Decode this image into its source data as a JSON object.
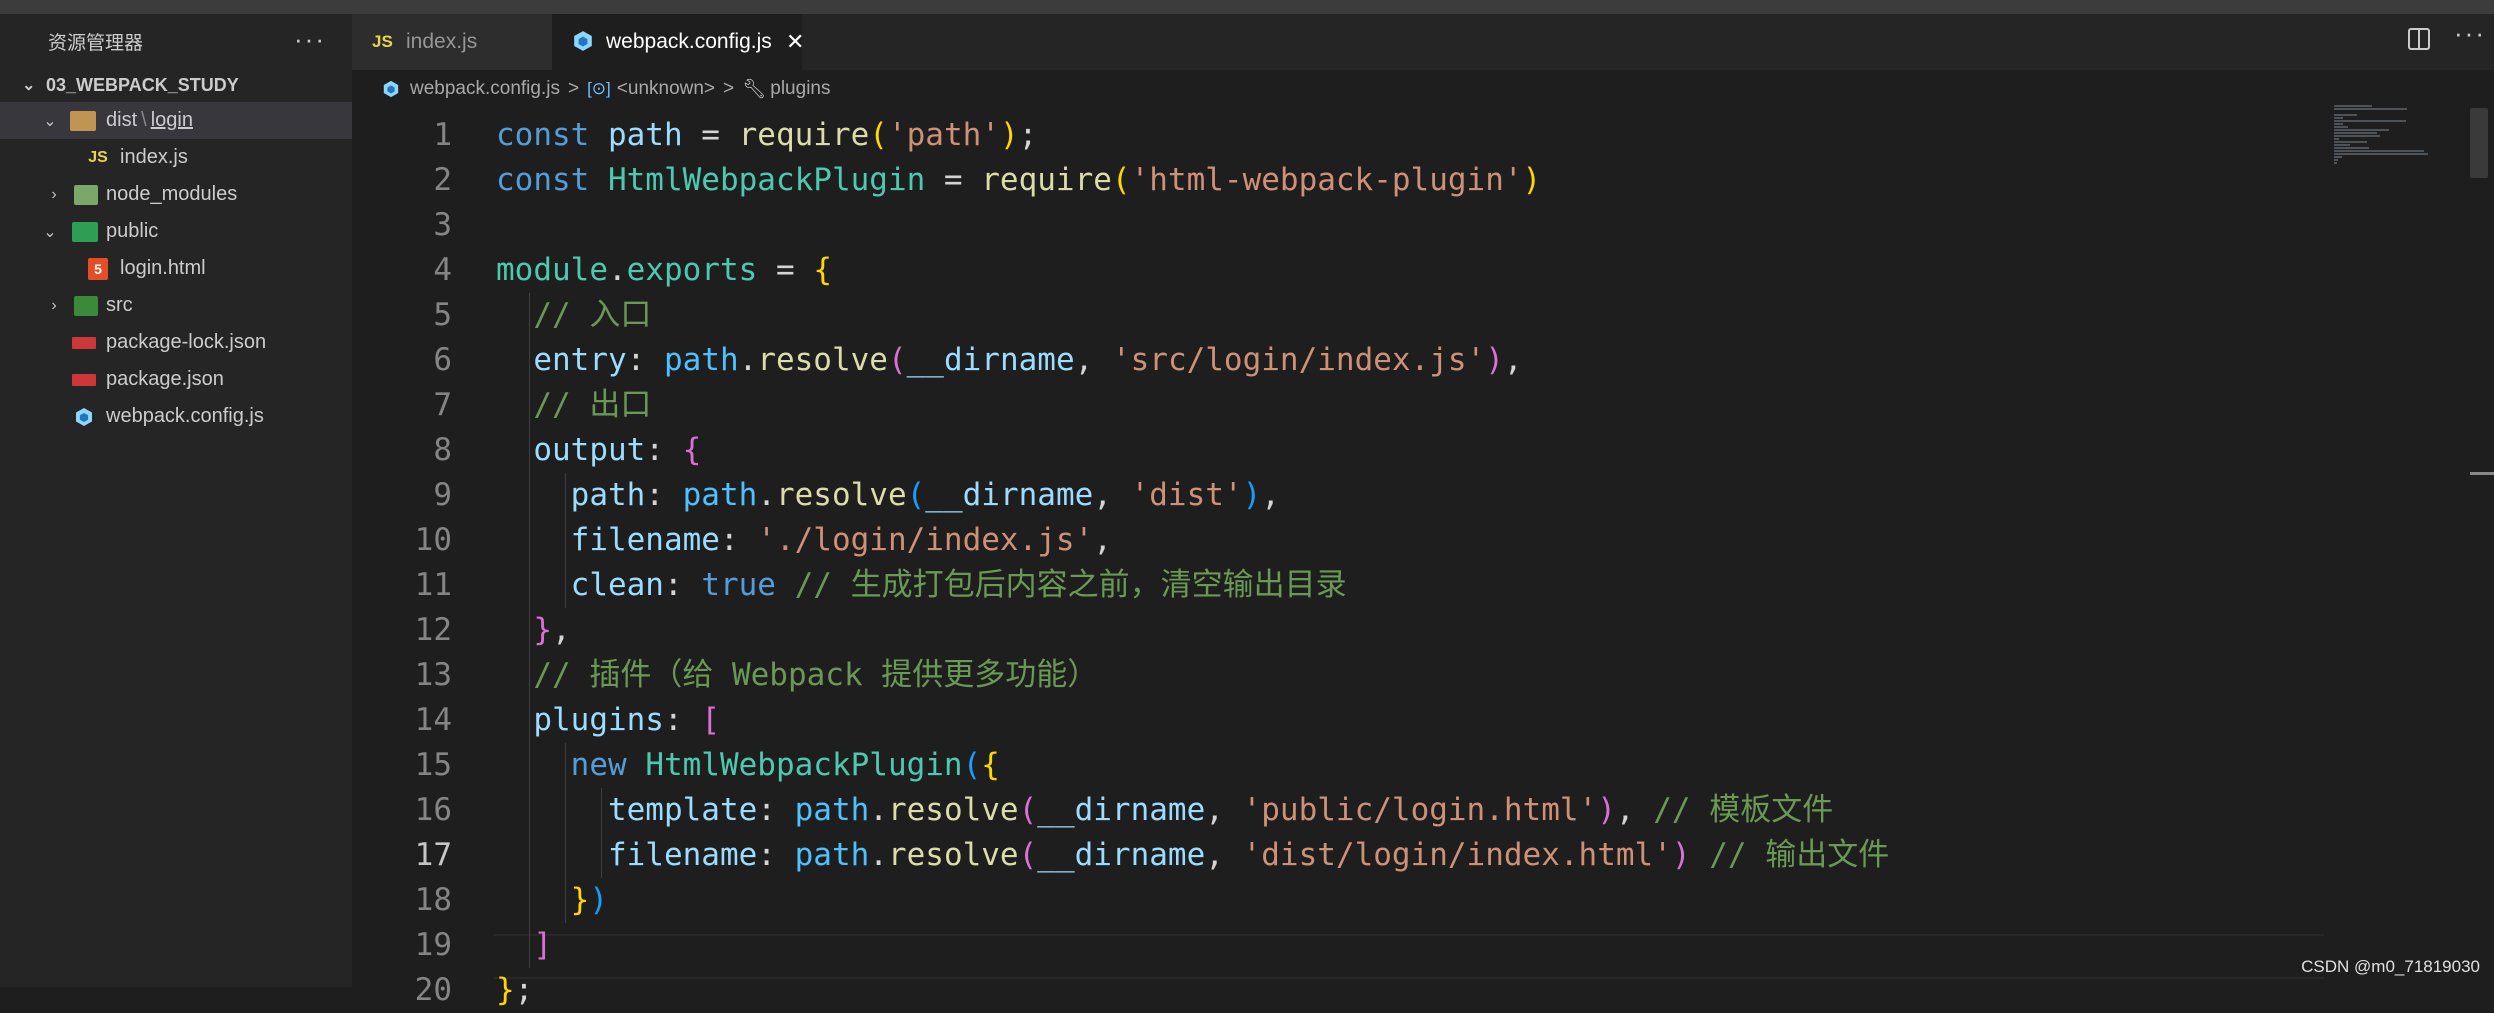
{
  "sidebar": {
    "title": "资源管理器",
    "more": "···",
    "project": "03_WEBPACK_STUDY",
    "tree": [
      {
        "parts": [
          "dist",
          "login"
        ],
        "icon": "folder-dist-open-icon",
        "expanded": true,
        "active": true
      },
      {
        "label": "index.js",
        "icon": "js-file-icon",
        "icon_text": "JS"
      },
      {
        "label": "node_modules",
        "icon": "folder-node-icon",
        "expanded": false
      },
      {
        "label": "public",
        "icon": "folder-public-open-icon",
        "expanded": true
      },
      {
        "label": "login.html",
        "icon": "html-file-icon",
        "icon_text": "5"
      },
      {
        "label": "src",
        "icon": "folder-src-icon",
        "expanded": false
      },
      {
        "label": "package-lock.json",
        "icon": "npm-file-icon"
      },
      {
        "label": "package.json",
        "icon": "npm-file-icon"
      },
      {
        "label": "webpack.config.js",
        "icon": "webpack-file-icon"
      }
    ]
  },
  "tabs": [
    {
      "label": "index.js",
      "icon": "js-file-icon",
      "icon_text": "JS",
      "active": false
    },
    {
      "label": "webpack.config.js",
      "icon": "webpack-file-icon",
      "active": true,
      "close": "✕"
    }
  ],
  "breadcrumb": {
    "file": "webpack.config.js",
    "symbol1": "<unknown>",
    "symbol2": "plugins",
    "separator": ">"
  },
  "editor": {
    "current_line": 17,
    "lines": [
      {
        "n": "1",
        "tokens": [
          [
            "kw",
            "const "
          ],
          [
            "prop",
            "path"
          ],
          [
            "op",
            " = "
          ],
          [
            "fn",
            "require"
          ],
          [
            "b1",
            "("
          ],
          [
            "str",
            "'path'"
          ],
          [
            "b1",
            ")"
          ],
          [
            "op",
            ";"
          ]
        ]
      },
      {
        "n": "2",
        "tokens": [
          [
            "kw",
            "const "
          ],
          [
            "cls",
            "HtmlWebpackPlugin"
          ],
          [
            "op",
            " = "
          ],
          [
            "fn",
            "require"
          ],
          [
            "b1",
            "("
          ],
          [
            "str",
            "'html-webpack-plugin'"
          ],
          [
            "b1",
            ")"
          ]
        ]
      },
      {
        "n": "3",
        "tokens": []
      },
      {
        "n": "4",
        "tokens": [
          [
            "cls",
            "module"
          ],
          [
            "op",
            "."
          ],
          [
            "cls",
            "exports"
          ],
          [
            "op",
            " = "
          ],
          [
            "b1",
            "{"
          ]
        ]
      },
      {
        "n": "5",
        "tokens": [
          [
            "op",
            "  "
          ],
          [
            "cm",
            "// 入口"
          ]
        ]
      },
      {
        "n": "6",
        "tokens": [
          [
            "op",
            "  "
          ],
          [
            "prop",
            "entry"
          ],
          [
            "op",
            ": "
          ],
          [
            "var",
            "path"
          ],
          [
            "op",
            "."
          ],
          [
            "fn",
            "resolve"
          ],
          [
            "b2",
            "("
          ],
          [
            "prop",
            "__dirname"
          ],
          [
            "op",
            ", "
          ],
          [
            "str",
            "'src/login/index.js'"
          ],
          [
            "b2",
            ")"
          ],
          [
            "op",
            ","
          ]
        ]
      },
      {
        "n": "7",
        "tokens": [
          [
            "op",
            "  "
          ],
          [
            "cm",
            "// 出口"
          ]
        ]
      },
      {
        "n": "8",
        "tokens": [
          [
            "op",
            "  "
          ],
          [
            "prop",
            "output"
          ],
          [
            "op",
            ": "
          ],
          [
            "b2",
            "{"
          ]
        ]
      },
      {
        "n": "9",
        "tokens": [
          [
            "op",
            "    "
          ],
          [
            "prop",
            "path"
          ],
          [
            "op",
            ": "
          ],
          [
            "var",
            "path"
          ],
          [
            "op",
            "."
          ],
          [
            "fn",
            "resolve"
          ],
          [
            "b3",
            "("
          ],
          [
            "prop",
            "__dirname"
          ],
          [
            "op",
            ", "
          ],
          [
            "str",
            "'dist'"
          ],
          [
            "b3",
            ")"
          ],
          [
            "op",
            ","
          ]
        ]
      },
      {
        "n": "10",
        "tokens": [
          [
            "op",
            "    "
          ],
          [
            "prop",
            "filename"
          ],
          [
            "op",
            ": "
          ],
          [
            "str",
            "'./login/index.js'"
          ],
          [
            "op",
            ","
          ]
        ]
      },
      {
        "n": "11",
        "tokens": [
          [
            "op",
            "    "
          ],
          [
            "prop",
            "clean"
          ],
          [
            "op",
            ": "
          ],
          [
            "kw",
            "true"
          ],
          [
            "op",
            " "
          ],
          [
            "cm",
            "// 生成打包后内容之前，清空输出目录"
          ]
        ]
      },
      {
        "n": "12",
        "tokens": [
          [
            "op",
            "  "
          ],
          [
            "b2",
            "}"
          ],
          [
            "op",
            ","
          ]
        ]
      },
      {
        "n": "13",
        "tokens": [
          [
            "op",
            "  "
          ],
          [
            "cm",
            "// 插件（给 Webpack 提供更多功能）"
          ]
        ]
      },
      {
        "n": "14",
        "tokens": [
          [
            "op",
            "  "
          ],
          [
            "prop",
            "plugins"
          ],
          [
            "op",
            ": "
          ],
          [
            "b2",
            "["
          ]
        ]
      },
      {
        "n": "15",
        "tokens": [
          [
            "op",
            "    "
          ],
          [
            "kw",
            "new "
          ],
          [
            "cls",
            "HtmlWebpackPlugin"
          ],
          [
            "b3",
            "("
          ],
          [
            "b1",
            "{"
          ]
        ]
      },
      {
        "n": "16",
        "tokens": [
          [
            "op",
            "      "
          ],
          [
            "prop",
            "template"
          ],
          [
            "op",
            ": "
          ],
          [
            "var",
            "path"
          ],
          [
            "op",
            "."
          ],
          [
            "fn",
            "resolve"
          ],
          [
            "b2",
            "("
          ],
          [
            "prop",
            "__dirname"
          ],
          [
            "op",
            ", "
          ],
          [
            "str",
            "'public/login.html'"
          ],
          [
            "b2",
            ")"
          ],
          [
            "op",
            ", "
          ],
          [
            "cm",
            "// 模板文件"
          ]
        ]
      },
      {
        "n": "17",
        "tokens": [
          [
            "op",
            "      "
          ],
          [
            "prop",
            "filename"
          ],
          [
            "op",
            ": "
          ],
          [
            "var",
            "path"
          ],
          [
            "op",
            "."
          ],
          [
            "fn",
            "resolve"
          ],
          [
            "b2",
            "("
          ],
          [
            "prop",
            "__dirname"
          ],
          [
            "op",
            ", "
          ],
          [
            "str",
            "'dist/login/index.html'"
          ],
          [
            "b2",
            ")"
          ],
          [
            "op",
            " "
          ],
          [
            "cm",
            "// 输出文件"
          ]
        ]
      },
      {
        "n": "18",
        "tokens": [
          [
            "op",
            "    "
          ],
          [
            "b1",
            "}"
          ],
          [
            "b3",
            ")"
          ]
        ]
      },
      {
        "n": "19",
        "tokens": [
          [
            "op",
            "  "
          ],
          [
            "b2",
            "]"
          ]
        ]
      },
      {
        "n": "20",
        "tokens": [
          [
            "b1",
            "}"
          ],
          [
            "op",
            ";"
          ]
        ]
      }
    ]
  },
  "watermark": "CSDN @m0_71819030"
}
